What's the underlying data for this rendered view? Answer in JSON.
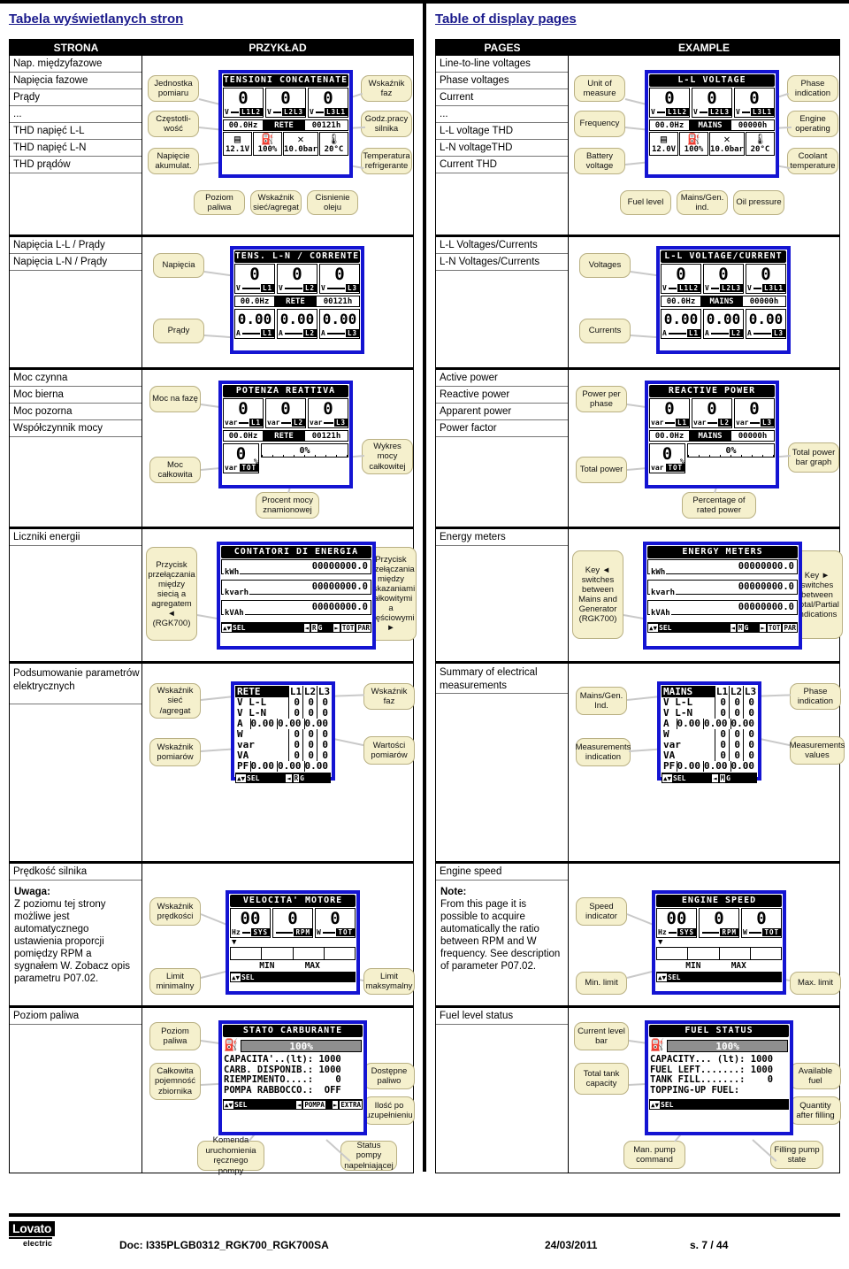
{
  "topbar": {},
  "left": {
    "heading": "Tabela wyświetlanych stron",
    "header": {
      "pages": "STRONA",
      "example": "PRZYKŁAD"
    },
    "sections": [
      {
        "pages": [
          "Nap. międzyfazowe",
          "Napięcia fazowe",
          "Prądy",
          "...",
          "THD napięć L-L",
          "THD napięć L-N",
          "THD prądów"
        ],
        "callouts": [
          "Jednostka pomiaru",
          "Częstotli-wość",
          "Napięcie akumulat.",
          "Wskaźnik faz",
          "Godz.pracy silnika",
          "Temperatura refrigerante",
          "Poziom paliwa",
          "Wskaźnik sieć/agregat",
          "Cisnienie oleju"
        ],
        "screen": {
          "title": "TENSIONI CONCATENATE",
          "values": [
            "0",
            "0",
            "0"
          ],
          "units": [
            "V",
            "V",
            "V"
          ],
          "tags": [
            "L1L2",
            "L2L3",
            "L3L1"
          ],
          "freq": "00.0Hz",
          "source": "RETE",
          "hours": "00121h",
          "icons": [
            {
              "name": "battery-icon",
              "value": "12.1V"
            },
            {
              "name": "fuel-pump-icon",
              "value": "100%"
            },
            {
              "name": "oil-pressure-icon",
              "value": "10.0bar"
            },
            {
              "name": "coolant-temp-icon",
              "value": "20°C"
            }
          ]
        }
      },
      {
        "pages": [
          "Napięcia L-L / Prądy",
          "Napięcia L-N / Prądy"
        ],
        "callouts": [
          "Napięcia",
          "Prądy"
        ],
        "screen": {
          "title": "TENS. L-N / CORRENTE",
          "values": [
            "0",
            "0",
            "0"
          ],
          "units": [
            "V",
            "V",
            "V"
          ],
          "tags": [
            "L1",
            "L2",
            "L3"
          ],
          "freq": "00.0Hz",
          "source": "RETE",
          "hours": "00121h",
          "values2": [
            "0.00",
            "0.00",
            "0.00"
          ],
          "units2": [
            "A",
            "A",
            "A"
          ],
          "tags2": [
            "L1",
            "L2",
            "L3"
          ]
        }
      },
      {
        "pages": [
          "Moc czynna",
          "Moc bierna",
          "Moc pozorna",
          "Współczynnik mocy"
        ],
        "callouts": [
          "Moc na fazę",
          "Moc całkowita",
          "Procent mocy znamionowej",
          "Wykres mocy całkowitej"
        ],
        "screen": {
          "title": "POTENZA REATTIVA",
          "values": [
            "0",
            "0",
            "0"
          ],
          "units": [
            "var",
            "var",
            "var"
          ],
          "tags": [
            "L1",
            "L2",
            "L3"
          ],
          "freq": "00.0Hz",
          "source": "RETE",
          "hours": "00121h",
          "total": "0",
          "total_unit": "var",
          "total_tag": "TOT",
          "pct_unit": "%",
          "bar_label": "0%"
        }
      },
      {
        "pages": [
          "Liczniki energii"
        ],
        "callouts": [
          "Przycisk przełączania między siecią a agregatem ◄ (RGK700)",
          "Przycisk przełączania między wskazaniami całkowitymi a częściowymi ►"
        ],
        "screen": {
          "title": "CONTATORI DI ENERGIA",
          "meters": [
            {
              "unit": "kWh",
              "value": "00000000.0"
            },
            {
              "unit": "kvarh",
              "value": "00000000.0"
            },
            {
              "unit": "kVAh",
              "value": "00000000.0"
            }
          ],
          "softkeys": {
            "sel": "SEL",
            "left": "◄",
            "src1": "R",
            "src2": "G",
            "right": "►",
            "tot": "TOT",
            "par": "PAR"
          }
        }
      },
      {
        "pages": [
          "Podsumowanie parametrów elektrycznych"
        ],
        "callouts": [
          "Wskaźnik sieć /agregat",
          "Wskaźnik pomiarów",
          "Wskaźnik faz",
          "Wartości pomiarów"
        ],
        "screen": {
          "source": "RETE",
          "cols": [
            "L1",
            "L2",
            "L3"
          ],
          "rows": [
            {
              "label": "V L-L",
              "values": [
                "0",
                "0",
                "0"
              ]
            },
            {
              "label": "V L-N",
              "values": [
                "0",
                "0",
                "0"
              ]
            },
            {
              "label": "A",
              "values": [
                "0.00",
                "0.00",
                "0.00"
              ]
            },
            {
              "label": "W",
              "values": [
                "0",
                "0",
                "0"
              ]
            },
            {
              "label": "var",
              "values": [
                "0",
                "0",
                "0"
              ]
            },
            {
              "label": "VA",
              "values": [
                "0",
                "0",
                "0"
              ]
            },
            {
              "label": "PF",
              "values": [
                "0.00",
                "0.00",
                "0.00"
              ]
            }
          ],
          "softkeys": {
            "sel": "SEL",
            "left": "◄",
            "src1": "R",
            "src2": "G"
          }
        }
      },
      {
        "pages": [
          "Prędkość silnika"
        ],
        "note": "Uwaga:\nZ poziomu tej strony możliwe jest automatycznego ustawienia proporcji pomiędzy RPM a sygnałem W. Zobacz opis parametru P07.02.",
        "note_bold": "Uwaga:",
        "note_body": "Z poziomu tej strony możliwe jest automatycznego ustawienia proporcji pomiędzy RPM a sygnałem W. Zobacz opis parametru P07.02.",
        "callouts": [
          "Wskaźnik prędkości",
          "Limit minimalny",
          "Limit maksymalny"
        ],
        "screen": {
          "title": "VELOCITA' MOTORE",
          "values": [
            "00",
            "0",
            "0"
          ],
          "units": [
            "Hz",
            "",
            "W"
          ],
          "tags": [
            "SYS",
            "RPM",
            "TOT"
          ],
          "min_label": "MIN",
          "max_label": "MAX",
          "softkeys": {
            "sel": "SEL"
          }
        }
      },
      {
        "pages": [
          "Poziom paliwa"
        ],
        "callouts": [
          "Poziom paliwa",
          "Całkowita pojemność zbiornika",
          "Komenda uruchomienia ręcznego pompy",
          "Dostępne paliwo",
          "Ilość po uzupełnieniu",
          "Status pompy napełniającej"
        ],
        "screen": {
          "title": "STATO CARBURANTE",
          "bar_label": "100%",
          "lines": [
            "CAPACITA'..(lt): 1000",
            "CARB. DISPONIB.: 1000",
            "RIEMPIMENTO....:    0",
            "POMPA RABBOCCO.:  OFF"
          ],
          "softkeys": {
            "sel": "SEL",
            "left": "◄",
            "pump": "POMPA",
            "right": "►",
            "extra": "EXTRA"
          }
        }
      }
    ]
  },
  "right": {
    "heading": "Table of display pages",
    "header": {
      "pages": "PAGES",
      "example": "EXAMPLE"
    },
    "sections": [
      {
        "pages": [
          "Line-to-line voltages",
          "Phase voltages",
          "Current",
          "...",
          "L-L voltage THD",
          "L-N voltageTHD",
          "Current THD"
        ],
        "callouts": [
          "Unit of measure",
          "Frequency",
          "Battery voltage",
          "Phase indication",
          "Engine operating",
          "Coolant temperature",
          "Fuel level",
          "Mains/Gen. ind.",
          "Oil pressure"
        ],
        "screen": {
          "title": "L-L VOLTAGE",
          "values": [
            "0",
            "0",
            "0"
          ],
          "units": [
            "V",
            "V",
            "V"
          ],
          "tags": [
            "L1L2",
            "L2L3",
            "L3L1"
          ],
          "freq": "00.0Hz",
          "source": "MAINS",
          "hours": "00000h",
          "icons": [
            {
              "name": "battery-icon",
              "value": "12.0V"
            },
            {
              "name": "fuel-pump-icon",
              "value": "100%"
            },
            {
              "name": "oil-pressure-icon",
              "value": "10.0bar"
            },
            {
              "name": "coolant-temp-icon",
              "value": "20°C"
            }
          ]
        }
      },
      {
        "pages": [
          "L-L Voltages/Currents",
          "L-N Voltages/Currents"
        ],
        "callouts": [
          "Voltages",
          "Currents"
        ],
        "screen": {
          "title": "L-L VOLTAGE/CURRENT",
          "values": [
            "0",
            "0",
            "0"
          ],
          "units": [
            "V",
            "V",
            "V"
          ],
          "tags": [
            "L1L2",
            "L2L3",
            "L3L1"
          ],
          "freq": "00.0Hz",
          "source": "MAINS",
          "hours": "00000h",
          "values2": [
            "0.00",
            "0.00",
            "0.00"
          ],
          "units2": [
            "A",
            "A",
            "A"
          ],
          "tags2": [
            "L1",
            "L2",
            "L3"
          ]
        }
      },
      {
        "pages": [
          "Active power",
          "Reactive power",
          "Apparent power",
          "Power factor"
        ],
        "callouts": [
          "Power per phase",
          "Total power",
          "Percentage of rated power",
          "Total power bar graph"
        ],
        "screen": {
          "title": "REACTIVE POWER",
          "values": [
            "0",
            "0",
            "0"
          ],
          "units": [
            "var",
            "var",
            "var"
          ],
          "tags": [
            "L1",
            "L2",
            "L3"
          ],
          "freq": "00.0Hz",
          "source": "MAINS",
          "hours": "00000h",
          "total": "0",
          "total_unit": "var",
          "total_tag": "TOT",
          "pct_unit": "%",
          "bar_label": "0%"
        }
      },
      {
        "pages": [
          "Energy meters"
        ],
        "callouts": [
          "Key ◄ switches between Mains and Generator (RGK700)",
          "Key ► switches between Total/Partial indications"
        ],
        "screen": {
          "title": "ENERGY METERS",
          "meters": [
            {
              "unit": "kWh",
              "value": "00000000.0"
            },
            {
              "unit": "kvarh",
              "value": "00000000.0"
            },
            {
              "unit": "kVAh",
              "value": "00000000.0"
            }
          ],
          "softkeys": {
            "sel": "SEL",
            "left": "◄",
            "src1": "M",
            "src2": "G",
            "right": "►",
            "tot": "TOT",
            "par": "PAR"
          }
        }
      },
      {
        "pages": [
          "Summary of electrical measurements"
        ],
        "callouts": [
          "Mains/Gen. Ind.",
          "Measurements indication",
          "Phase indication",
          "Measurements values"
        ],
        "screen": {
          "source": "MAINS",
          "cols": [
            "L1",
            "L2",
            "L3"
          ],
          "rows": [
            {
              "label": "V L-L",
              "values": [
                "0",
                "0",
                "0"
              ]
            },
            {
              "label": "V L-N",
              "values": [
                "0",
                "0",
                "0"
              ]
            },
            {
              "label": "A",
              "values": [
                "0.00",
                "0.00",
                "0.00"
              ]
            },
            {
              "label": "W",
              "values": [
                "0",
                "0",
                "0"
              ]
            },
            {
              "label": "var",
              "values": [
                "0",
                "0",
                "0"
              ]
            },
            {
              "label": "VA",
              "values": [
                "0",
                "0",
                "0"
              ]
            },
            {
              "label": "PF",
              "values": [
                "0.00",
                "0.00",
                "0.00"
              ]
            }
          ],
          "softkeys": {
            "sel": "SEL",
            "left": "◄",
            "src1": "M",
            "src2": "G"
          }
        }
      },
      {
        "pages": [
          "Engine speed"
        ],
        "note_bold": "Note:",
        "note_body": "From this page it is possible to acquire automatically the ratio between RPM and W frequency. See description of parameter P07.02.",
        "callouts": [
          "Speed indicator",
          "Min. limit",
          "Max. limit"
        ],
        "screen": {
          "title": "ENGINE SPEED",
          "values": [
            "00",
            "0",
            "0"
          ],
          "units": [
            "Hz",
            "",
            "W"
          ],
          "tags": [
            "SYS",
            "RPM",
            "TOT"
          ],
          "min_label": "MIN",
          "max_label": "MAX",
          "softkeys": {
            "sel": "SEL"
          }
        }
      },
      {
        "pages": [
          "Fuel level status"
        ],
        "callouts": [
          "Current level bar",
          "Total tank capacity",
          "Man. pump command",
          "Available fuel",
          "Quantity after filling",
          "Filling pump state"
        ],
        "screen": {
          "title": "FUEL STATUS",
          "bar_label": "100%",
          "lines": [
            "CAPACITY... (lt): 1000",
            "FUEL LEFT.......: 1000",
            "TANK FILL.......:    0",
            "TOPPING-UP FUEL:"
          ],
          "softkeys": {
            "sel": "SEL"
          }
        }
      }
    ]
  },
  "footer": {
    "logo_main": "Lovato",
    "logo_sub": "electric",
    "doc": "Doc: I335PLGB0312_RGK700_RGK700SA",
    "date": "24/03/2011",
    "page": "s. 7 / 44"
  },
  "colors": {
    "lcd_border": "#1414d2",
    "callout_bg": "#f5f0cd",
    "heading": "#1a1a8c"
  }
}
